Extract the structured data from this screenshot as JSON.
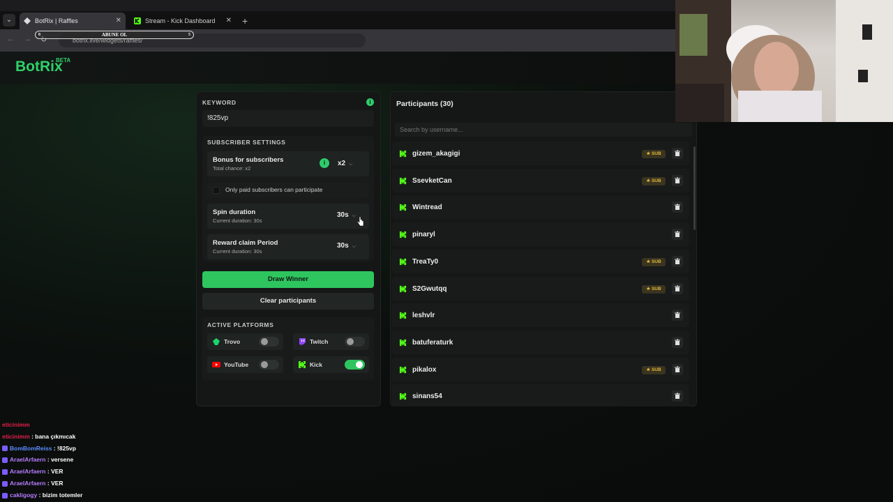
{
  "browser": {
    "tabs": [
      {
        "title": "BotRix | Raffles",
        "active": true
      },
      {
        "title": "Stream - Kick Dashboard",
        "active": false
      }
    ],
    "url": "botrix.live/widgets/raffles/",
    "overlay": {
      "text": "ABUNE OL",
      "left_num": "0",
      "right_num": "5"
    }
  },
  "app": {
    "logo": "BotRix",
    "logo_badge": "BETA"
  },
  "raffle": {
    "keyword_label": "KEYWORD",
    "keyword_value": "!825vp",
    "subscriber_settings_label": "SUBSCRIBER SETTINGS",
    "bonus_title": "Bonus for subscribers",
    "bonus_sub": "Total chance: x2",
    "bonus_value": "x2",
    "paid_only_label": "Only paid subscribers can participate",
    "spin_title": "Spin duration",
    "spin_sub": "Current duration: 30s",
    "spin_value": "30s",
    "claim_title": "Reward claim Period",
    "claim_sub": "Current duration: 30s",
    "claim_value": "30s",
    "draw_button": "Draw Winner",
    "clear_button": "Clear participants",
    "platforms_label": "ACTIVE PLATFORMS",
    "platforms": [
      {
        "name": "Trovo",
        "enabled": false,
        "color": "#19d66b"
      },
      {
        "name": "Twitch",
        "enabled": false,
        "color": "#9146ff"
      },
      {
        "name": "YouTube",
        "enabled": false,
        "color": "#ff0000"
      },
      {
        "name": "Kick",
        "enabled": true,
        "color": "#53fc18"
      }
    ]
  },
  "participants": {
    "title": "Participants (30)",
    "search_placeholder": "Search by username...",
    "sub_label": "SUB",
    "items": [
      {
        "name": "gizem_akagigi",
        "sub": true
      },
      {
        "name": "SsevketCan",
        "sub": true
      },
      {
        "name": "Wintread",
        "sub": false
      },
      {
        "name": "pinaryl",
        "sub": false
      },
      {
        "name": "TreaTy0",
        "sub": true
      },
      {
        "name": "S2Gwutqq",
        "sub": true
      },
      {
        "name": "leshvlr",
        "sub": false
      },
      {
        "name": "batuferaturk",
        "sub": false
      },
      {
        "name": "pikalox",
        "sub": true
      },
      {
        "name": "sinans54",
        "sub": false
      }
    ]
  },
  "chat": [
    {
      "user": "eticinimm",
      "msg": "",
      "color": "#e0204a"
    },
    {
      "user": "eticinimm",
      "msg": ": bana çıkmıcak",
      "color": "#e0204a"
    },
    {
      "user": "BomBomReiss",
      "msg": ": !825vp",
      "color": "#5b8cff"
    },
    {
      "user": "AraelArfaern",
      "msg": ": versene",
      "color": "#b57cff"
    },
    {
      "user": "AraelArfaern",
      "msg": ": VER",
      "color": "#b57cff"
    },
    {
      "user": "AraelArfaern",
      "msg": ": VER",
      "color": "#b57cff"
    },
    {
      "user": "cakligogy",
      "msg": ": bizim totemler",
      "color": "#b57cff"
    }
  ]
}
